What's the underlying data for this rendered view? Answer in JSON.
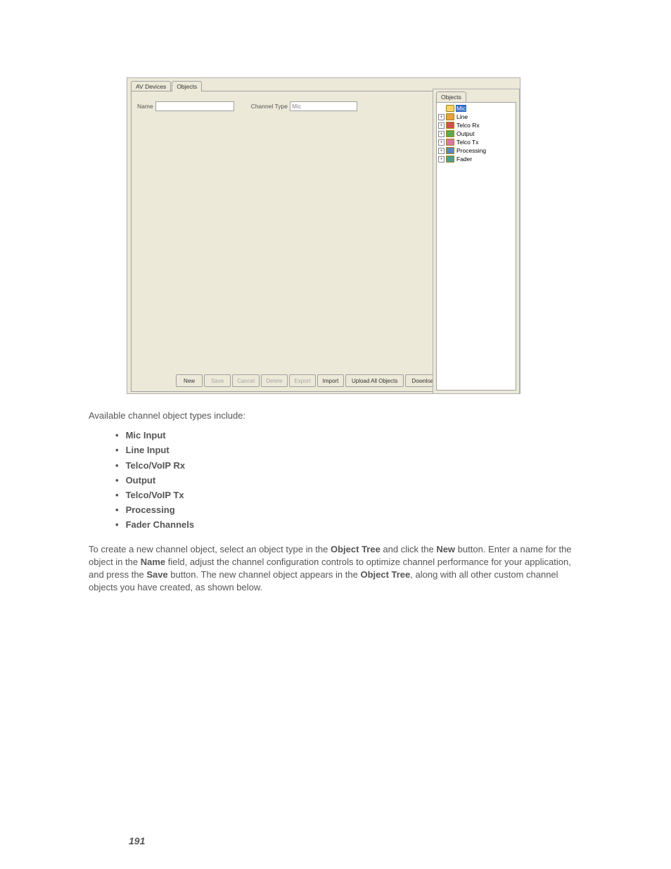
{
  "app": {
    "tabs": {
      "av_devices": "AV Devices",
      "objects": "Objects"
    },
    "form": {
      "name_label": "Name",
      "name_value": "",
      "type_label": "Channel Type",
      "type_value": "Mic"
    },
    "buttons": {
      "new": "New",
      "save": "Save",
      "cancel": "Cancel",
      "delete": "Delete",
      "export": "Export",
      "import": "Import",
      "upload": "Upload All Objects",
      "download": "Download All Objects"
    }
  },
  "objects_panel": {
    "tab": "Objects",
    "items": [
      {
        "label": "Mic",
        "icon": "ic-yellow",
        "selected": true,
        "expandable": false
      },
      {
        "label": "Line",
        "icon": "ic-orange",
        "selected": false,
        "expandable": true
      },
      {
        "label": "Telco Rx",
        "icon": "ic-red",
        "selected": false,
        "expandable": true
      },
      {
        "label": "Output",
        "icon": "ic-green",
        "selected": false,
        "expandable": true
      },
      {
        "label": "Telco Tx",
        "icon": "ic-pink",
        "selected": false,
        "expandable": true
      },
      {
        "label": "Processing",
        "icon": "ic-blue",
        "selected": false,
        "expandable": true
      },
      {
        "label": "Fader",
        "icon": "ic-teal",
        "selected": false,
        "expandable": true
      }
    ]
  },
  "doc": {
    "intro": "Available channel object types include:",
    "types": [
      "Mic Input",
      "Line Input",
      "Telco/VoIP Rx",
      "Output",
      "Telco/VoIP Tx",
      "Processing",
      "Fader Channels"
    ],
    "para": {
      "t1": "To create a new channel object, select an object type in the ",
      "b1": "Object Tree",
      "t2": " and click the ",
      "b2": "New",
      "t3": " button. Enter a name for the object in the ",
      "b3": "Name",
      "t4": " field, adjust the channel configuration controls to optimize channel performance for your application, and press the ",
      "b4": "Save",
      "t5": " button. The new channel object appears in the ",
      "b5": "Object Tree",
      "t6": ", along with all other custom channel objects you have created, as shown below."
    }
  },
  "page_number": "191"
}
